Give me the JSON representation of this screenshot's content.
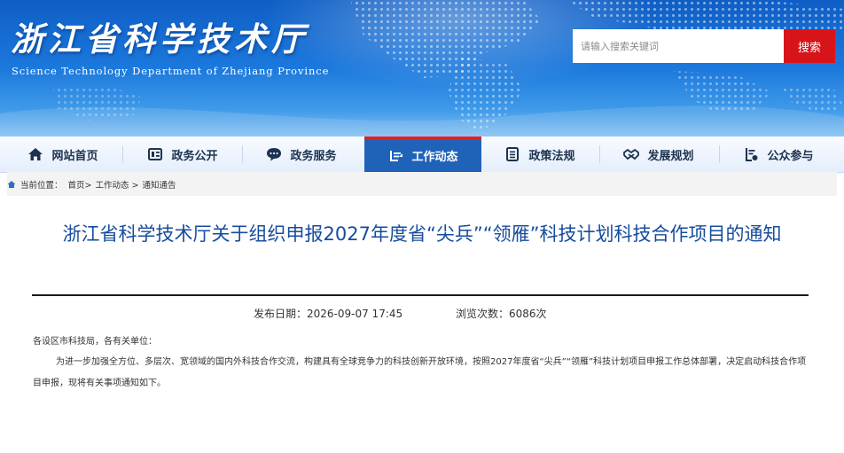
{
  "header": {
    "logo_cn": "浙江省科学技术厅",
    "logo_en": "Science Technology Department of Zhejiang Province",
    "search": {
      "placeholder": "请输入搜索关键词",
      "button_label": "搜索"
    }
  },
  "colors": {
    "banner_blue": "#1b78dc",
    "nav_active": "#1f63b9",
    "accent_red": "#d8141b",
    "title_blue": "#164c9e"
  },
  "nav": {
    "items": [
      {
        "label": "网站首页",
        "icon": "home-icon",
        "active": false
      },
      {
        "label": "政务公开",
        "icon": "news-icon",
        "active": false
      },
      {
        "label": "政务服务",
        "icon": "chat-icon",
        "active": false
      },
      {
        "label": "工作动态",
        "icon": "dynamics-icon",
        "active": true
      },
      {
        "label": "政策法规",
        "icon": "document-icon",
        "active": false
      },
      {
        "label": "发展规划",
        "icon": "handshake-icon",
        "active": false
      },
      {
        "label": "公众参与",
        "icon": "participation-icon",
        "active": false
      }
    ]
  },
  "breadcrumb": {
    "label": "当前位置：",
    "items": [
      "首页>",
      "工作动态 >",
      "通知通告"
    ]
  },
  "article": {
    "title": "浙江省科学技术厅关于组织申报2027年度省“尖兵”“领雁”科技计划科技合作项目的通知",
    "publish_date": "发布日期：2026-09-07 17:45",
    "views": "浏览次数：6086次",
    "salutation": "各设区市科技局，各有关单位：",
    "body": "为进一步加强全方位、多层次、宽领域的国内外科技合作交流，构建具有全球竞争力的科技创新开放环境，按照2027年度省“尖兵”“领雁”科技计划项目申报工作总体部署，决定启动科技合作项目申报，现将有关事项通知如下。"
  }
}
